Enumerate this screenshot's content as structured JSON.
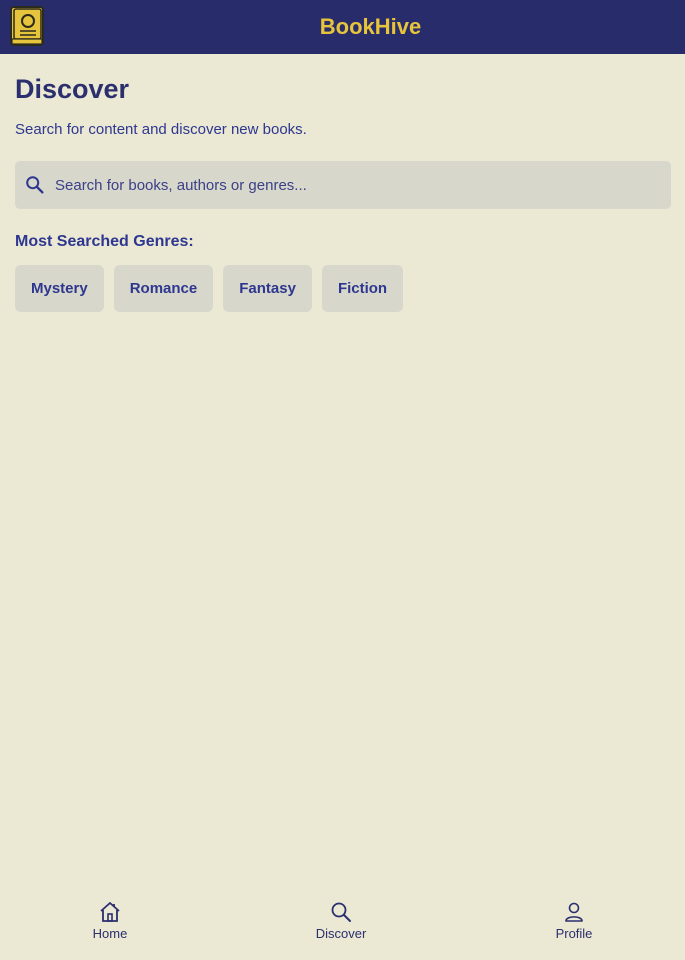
{
  "header": {
    "title": "BookHive",
    "logo_icon": "book-icon",
    "background": "#282c6a",
    "title_color": "#e6c43c"
  },
  "main": {
    "title": "Discover",
    "subtitle": "Search for content and discover new books.",
    "search": {
      "icon": "search-icon",
      "placeholder": "Search for books, authors or genres...",
      "value": ""
    },
    "genres_heading": "Most Searched Genres:",
    "genres": [
      "Mystery",
      "Romance",
      "Fantasy",
      "Fiction"
    ]
  },
  "bottom_nav": {
    "items": [
      {
        "label": "Home",
        "icon": "home-icon"
      },
      {
        "label": "Discover",
        "icon": "search-icon"
      },
      {
        "label": "Profile",
        "icon": "user-icon"
      }
    ]
  },
  "colors": {
    "background": "#ebe8d3",
    "text": "#2b2f6e",
    "chip_background": "#d8d7cb"
  }
}
